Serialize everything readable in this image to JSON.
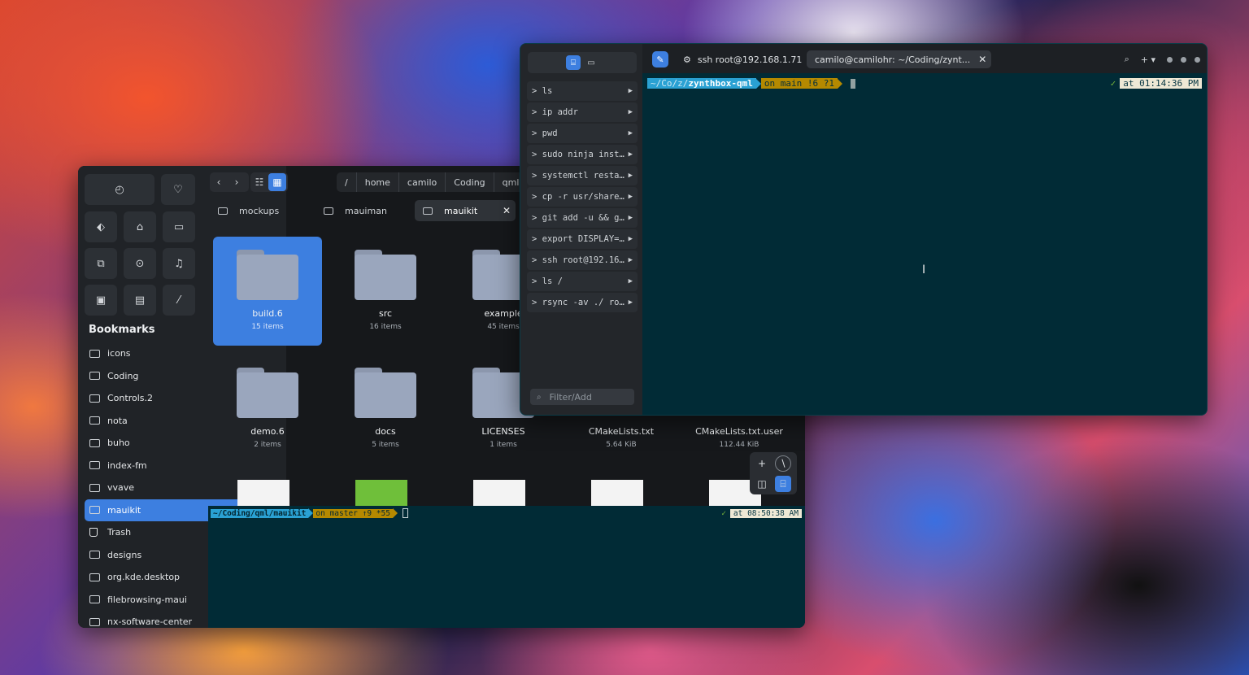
{
  "file_manager": {
    "quick_access": [
      {
        "icon": "recent-icon",
        "glyph": "◴"
      },
      {
        "icon": "favorite-icon",
        "glyph": "♡"
      },
      {
        "icon": "tag-icon",
        "glyph": "⬖"
      },
      {
        "icon": "home-icon",
        "glyph": "⌂"
      },
      {
        "icon": "drive-icon",
        "glyph": "▭"
      },
      {
        "icon": "documents-icon",
        "glyph": "⧉"
      },
      {
        "icon": "downloads-icon",
        "glyph": "⊙"
      },
      {
        "icon": "music-icon",
        "glyph": "♫"
      },
      {
        "icon": "pictures-icon",
        "glyph": "▣"
      },
      {
        "icon": "videos-icon",
        "glyph": "▤"
      },
      {
        "icon": "root-icon",
        "glyph": "⁄"
      }
    ],
    "bookmarks_title": "Bookmarks",
    "bookmarks": [
      {
        "label": "icons"
      },
      {
        "label": "Coding"
      },
      {
        "label": "Controls.2"
      },
      {
        "label": "nota"
      },
      {
        "label": "buho"
      },
      {
        "label": "index-fm"
      },
      {
        "label": "vvave"
      },
      {
        "label": "mauikit",
        "selected": true
      },
      {
        "label": "Trash",
        "icon": "trash"
      },
      {
        "label": "designs"
      },
      {
        "label": "org.kde.desktop"
      },
      {
        "label": "filebrowsing-maui"
      },
      {
        "label": "nx-software-center"
      }
    ],
    "breadcrumbs": [
      "/",
      "home",
      "camilo",
      "Coding",
      "qml"
    ],
    "tabs": [
      {
        "label": "mockups"
      },
      {
        "label": "mauiman"
      },
      {
        "label": "mauikit",
        "active": true,
        "close": "✕"
      }
    ],
    "items": [
      {
        "name": "build.6",
        "sub": "15 items",
        "kind": "folder",
        "selected": true
      },
      {
        "name": "src",
        "sub": "16 items",
        "kind": "folder"
      },
      {
        "name": "example",
        "sub": "45 items",
        "kind": "folder"
      },
      {
        "name": "demo.6",
        "sub": "2 items",
        "kind": "folder"
      },
      {
        "name": "docs",
        "sub": "5 items",
        "kind": "folder"
      },
      {
        "name": "LICENSES",
        "sub": "1 items",
        "kind": "folder"
      },
      {
        "name": "CMakeLists.txt",
        "sub": "5.64 KiB",
        "kind": "file"
      },
      {
        "name": "CMakeLists.txt.user",
        "sub": "112.44 KiB",
        "kind": "file"
      }
    ],
    "terminal": {
      "path_prefix": "~/Coding/qml/",
      "path_bold": "mauikit",
      "git": "on master ↑9 *55",
      "check": "✓",
      "time": "at 08:50:38 AM"
    }
  },
  "terminal_window": {
    "commands": [
      {
        "text": "> ls"
      },
      {
        "text": "> ip addr"
      },
      {
        "text": "> pwd"
      },
      {
        "text": "> sudo ninja inst…"
      },
      {
        "text": "> systemctl resta…"
      },
      {
        "text": "> cp -r usr/share…"
      },
      {
        "text": "> git add -u && g…"
      },
      {
        "text": "> export DISPLAY=…"
      },
      {
        "text": "> ssh root@192.16…"
      },
      {
        "text": "> ls /"
      },
      {
        "text": "> rsync -av ./ ro…"
      }
    ],
    "run_glyph": "▶",
    "filter_placeholder": "Filter/Add",
    "tabs": [
      {
        "label": "ssh root@192.168.1.71",
        "icon": "gear-icon"
      },
      {
        "label": "camilo@camilohr: ~/Coding/zynt...",
        "active": true,
        "close": "✕"
      }
    ],
    "prompt": {
      "path_dim": "~/Co/z/",
      "path_bold": "zynthbox-qml",
      "git": "on main !6 ?1",
      "check": "✓",
      "time": "at 01:14:36 PM"
    }
  },
  "colors": {
    "accent": "#3d7fe0",
    "terminal_bg": "#012b36",
    "path_segment": "#2aa1d3",
    "git_segment": "#b58900"
  }
}
